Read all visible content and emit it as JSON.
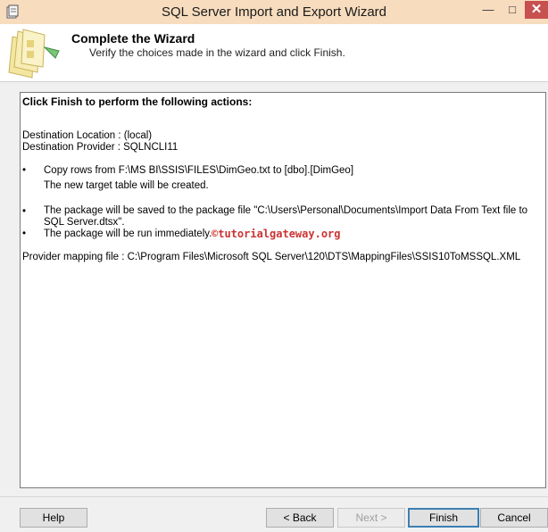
{
  "window": {
    "title": "SQL Server Import and Export Wizard",
    "min_glyph": "—",
    "max_glyph": "□",
    "close_glyph": "✕"
  },
  "header": {
    "title": "Complete the Wizard",
    "subtitle": "Verify the choices made in the wizard and click Finish."
  },
  "content": {
    "heading": "Click Finish to perform the following actions:",
    "destination_location": "Destination Location : (local)",
    "destination_provider": "Destination Provider : SQLNCLI11",
    "bullet_glyph": "•",
    "bullets": [
      {
        "line1": "Copy rows from F:\\MS BI\\SSIS\\FILES\\DimGeo.txt to [dbo].[DimGeo]",
        "line2": "The new target table will be created."
      },
      {
        "line1": "The package will be saved to the package file \"C:\\Users\\Personal\\Documents\\Import Data From Text file to SQL Server.dtsx\"."
      },
      {
        "line1": "The package will be run immediately."
      }
    ],
    "mapping_file": "Provider mapping file : C:\\Program Files\\Microsoft SQL Server\\120\\DTS\\MappingFiles\\SSIS10ToMSSQL.XML",
    "watermark": "©tutorialgateway.org"
  },
  "buttons": {
    "help": "Help",
    "back": "< Back",
    "next": "Next >",
    "finish": "Finish",
    "cancel": "Cancel"
  }
}
